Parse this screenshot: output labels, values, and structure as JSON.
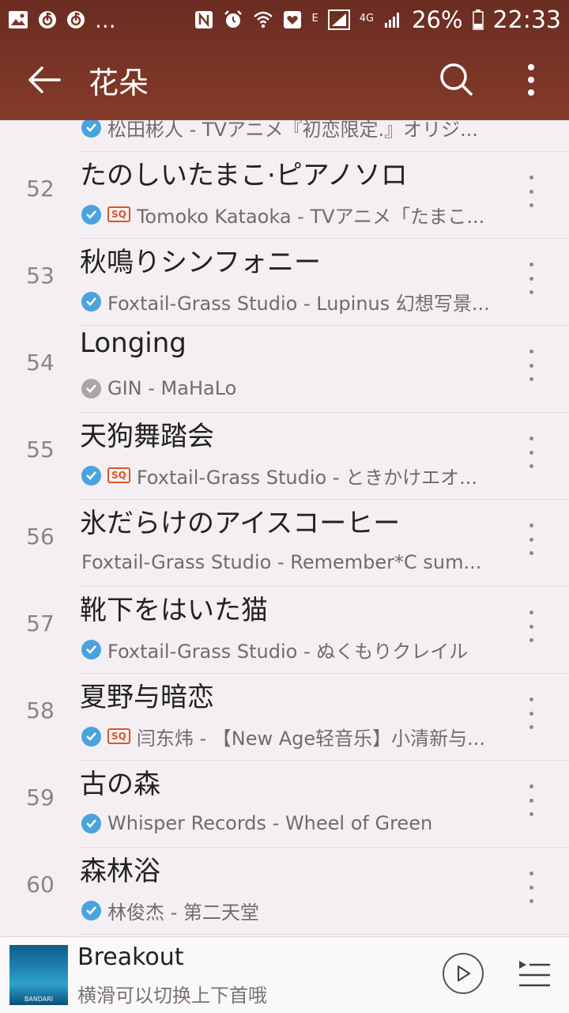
{
  "status_bar": {
    "ellipsis": "...",
    "network_e": "E",
    "network_4g": "4G",
    "battery": "26%",
    "time": "22:33"
  },
  "app_bar": {
    "title": "花朵"
  },
  "partial_row": {
    "subtitle": "松田彬人 - TVアニメ『初恋限定.』オリジ..."
  },
  "tracks": [
    {
      "num": "52",
      "title": "たのしいたまこ·ピアノソロ",
      "subtitle": "Tomoko Kataoka - TVアニメ「たまこ...",
      "check": "blue",
      "sq": true
    },
    {
      "num": "53",
      "title": "秋鳴りシンフォニー",
      "subtitle": "Foxtail-Grass Studio - Lupinus 幻想写景...",
      "check": "blue",
      "sq": false
    },
    {
      "num": "54",
      "title": "Longing",
      "subtitle": "GIN - MaHaLo",
      "check": "grey",
      "sq": false
    },
    {
      "num": "55",
      "title": "天狗舞踏会",
      "subtitle": "Foxtail-Grass Studio - ときかけエオ...",
      "check": "blue",
      "sq": true
    },
    {
      "num": "56",
      "title": "氷だらけのアイスコーヒー",
      "subtitle": "Foxtail-Grass Studio - Remember*C sum...",
      "check": "none",
      "sq": false
    },
    {
      "num": "57",
      "title": "靴下をはいた猫",
      "subtitle": "Foxtail-Grass Studio - ぬくもりクレイル",
      "check": "blue",
      "sq": false
    },
    {
      "num": "58",
      "title": "夏野与暗恋",
      "subtitle": "闫东炜 - 【New Age轻音乐】小清新与...",
      "check": "blue",
      "sq": true
    },
    {
      "num": "59",
      "title": "古の森",
      "subtitle": "Whisper Records - Wheel of Green",
      "check": "blue",
      "sq": false
    },
    {
      "num": "60",
      "title": "森林浴",
      "subtitle": "林俊杰 - 第二天堂",
      "check": "blue",
      "sq": false
    }
  ],
  "sq_badge": "SQ",
  "player": {
    "title": "Breakout",
    "hint": "横滑可以切换上下首哦",
    "cover_label": "BANDARI"
  },
  "colors": {
    "top_bar": "#7a3526",
    "check_blue": "#4aa3dc",
    "check_grey": "#a9a6a9",
    "sq_badge": "#d8572b"
  },
  "icons": [
    "back-arrow-icon",
    "search-icon",
    "more-vertical-icon",
    "check-circle-icon",
    "play-icon",
    "queue-icon"
  ]
}
